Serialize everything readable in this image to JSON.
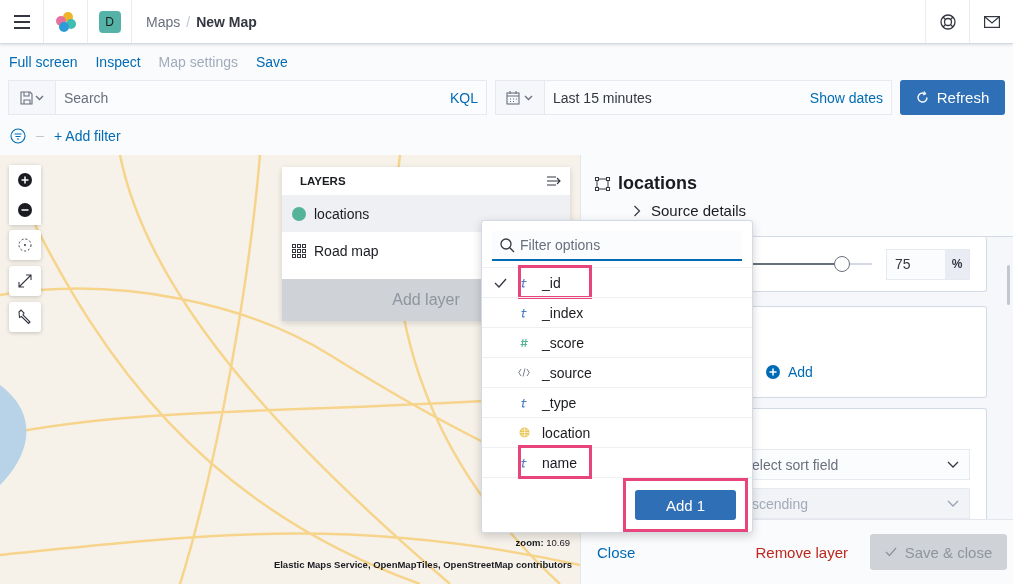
{
  "header": {
    "avatar": "D",
    "separator": "/",
    "breadcrumbs": [
      "Maps",
      "New Map"
    ]
  },
  "menu": [
    {
      "label": "Full screen",
      "disabled": false
    },
    {
      "label": "Inspect",
      "disabled": false
    },
    {
      "label": "Map settings",
      "disabled": true
    },
    {
      "label": "Save",
      "disabled": false
    }
  ],
  "query_bar": {
    "placeholder": "Search",
    "language": "KQL",
    "time_range": "Last 15 minutes",
    "show_dates": "Show dates",
    "refresh": "Refresh"
  },
  "filter_bar": {
    "add_filter": "+ Add filter"
  },
  "map": {
    "zoom_label": "zoom:",
    "zoom_value": "10.69",
    "attribution": "Elastic Maps Service, OpenMapTiles, OpenStreetMap contributors"
  },
  "layers_panel": {
    "title": "LAYERS",
    "layers": [
      {
        "name": "locations",
        "kind": "points",
        "color": "#54b399",
        "selected": true
      },
      {
        "name": "Road map",
        "kind": "tiles",
        "selected": false
      }
    ],
    "add_layer": "Add layer"
  },
  "field_picker": {
    "placeholder": "Filter options",
    "fields": [
      {
        "name": "_id",
        "kind": "string",
        "checked": true,
        "highlighted": true
      },
      {
        "name": "_index",
        "kind": "string",
        "checked": false,
        "highlighted": false
      },
      {
        "name": "_score",
        "kind": "number",
        "checked": false,
        "highlighted": false
      },
      {
        "name": "_source",
        "kind": "source",
        "checked": false,
        "highlighted": false
      },
      {
        "name": "_type",
        "kind": "string",
        "checked": false,
        "highlighted": false
      },
      {
        "name": "location",
        "kind": "geo",
        "checked": false,
        "highlighted": false
      },
      {
        "name": "name",
        "kind": "string",
        "checked": false,
        "highlighted": true
      }
    ],
    "add_button": {
      "label": "Add 1",
      "highlighted": true
    }
  },
  "layer_editor": {
    "title": "locations",
    "source_details": "Source details",
    "opacity": {
      "level": 0.75,
      "value": "75",
      "unit": "%"
    },
    "add_tooltip": "Add",
    "sort_field": "elect sort field",
    "sort_order": "scending",
    "close": "Close",
    "remove": "Remove layer",
    "save": {
      "label": "Save & close",
      "disabled": true
    }
  }
}
